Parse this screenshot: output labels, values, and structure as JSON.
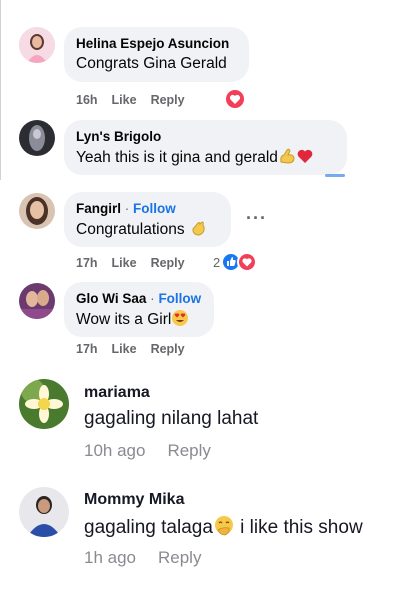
{
  "facebook_comments": [
    {
      "name": "Helina Espejo Asuncion",
      "follow": "",
      "text": "Congrats Gina Gerald",
      "time": "16h",
      "like": "Like",
      "reply": "Reply",
      "reaction_count": ""
    },
    {
      "name": "Lyn's Brigolo",
      "follow": "",
      "text": "Yeah this is it gina and gerald",
      "time": "",
      "like": "",
      "reply": "",
      "reaction_count": ""
    },
    {
      "name": "Fangirl",
      "follow": "Follow",
      "text": "Congratulations",
      "time": "17h",
      "like": "Like",
      "reply": "Reply",
      "reaction_count": "2"
    },
    {
      "name": "Glo Wi Saa",
      "follow": "Follow",
      "text": "Wow its a Girl",
      "time": "17h",
      "like": "Like",
      "reply": "Reply",
      "reaction_count": ""
    }
  ],
  "tiktok_comments": [
    {
      "name": "mariama",
      "text": "gagaling nilang lahat",
      "time": "10h ago",
      "reply": "Reply"
    },
    {
      "name": "Mommy Mika",
      "text": "gagaling talaga",
      "text_after": "i like this show",
      "time": "1h ago",
      "reply": "Reply"
    }
  ],
  "colors": {
    "bubble": "#f0f2f5",
    "follow": "#1b74e4",
    "muted": "#65676b",
    "love": "#f33e58",
    "like": "#1877f2"
  },
  "icons": [
    "heart-reaction-icon",
    "like-reaction-icon",
    "flexed-biceps-emoji",
    "red-heart-emoji",
    "clapping-hands-emoji",
    "heart-eyes-emoji",
    "smiling-face-hand-over-mouth-emoji",
    "more-options-icon"
  ]
}
